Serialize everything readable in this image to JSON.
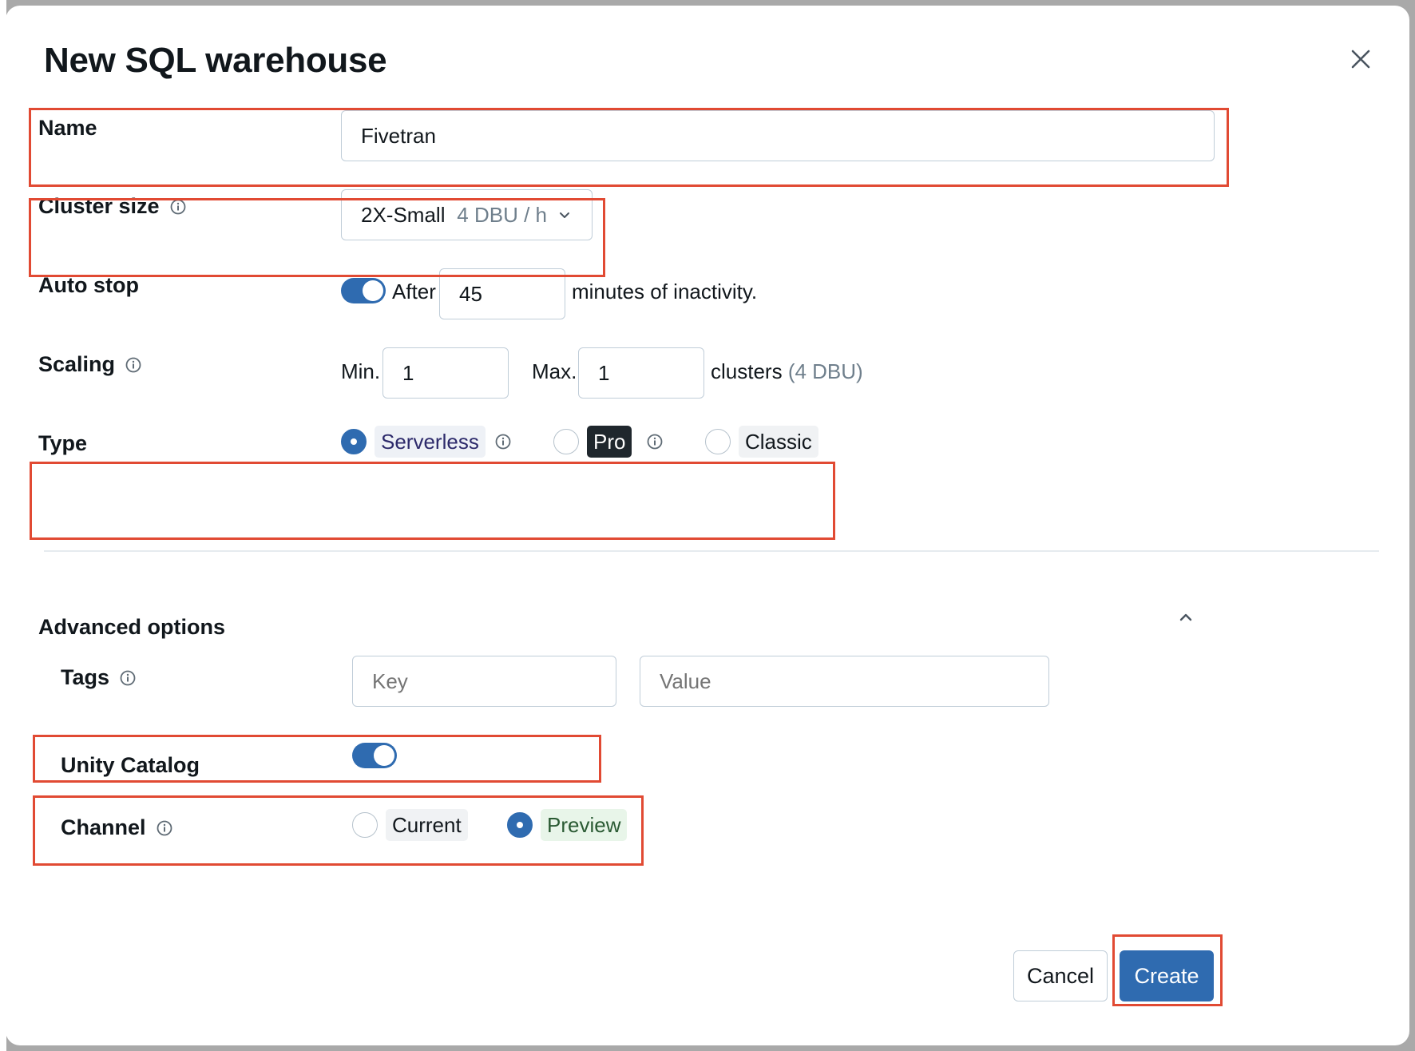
{
  "dialog": {
    "title": "New SQL warehouse",
    "close_icon": "close-icon"
  },
  "name": {
    "label": "Name",
    "value": "Fivetran"
  },
  "cluster_size": {
    "label": "Cluster size",
    "value": "2X-Small",
    "rate": "4 DBU / h"
  },
  "auto_stop": {
    "label": "Auto stop",
    "enabled": true,
    "prefix": "After",
    "value": "45",
    "suffix": "minutes of inactivity."
  },
  "scaling": {
    "label": "Scaling",
    "min_label": "Min.",
    "min_value": "1",
    "max_label": "Max.",
    "max_value": "1",
    "suffix": "clusters",
    "dbu": "(4 DBU)"
  },
  "type": {
    "label": "Type",
    "options": [
      {
        "label": "Serverless",
        "selected": true
      },
      {
        "label": "Pro",
        "selected": false
      },
      {
        "label": "Classic",
        "selected": false
      }
    ]
  },
  "advanced": {
    "label": "Advanced options",
    "tags": {
      "label": "Tags",
      "key_placeholder": "Key",
      "value_placeholder": "Value"
    },
    "unity_catalog": {
      "label": "Unity Catalog",
      "enabled": true
    },
    "channel": {
      "label": "Channel",
      "options": [
        {
          "label": "Current",
          "selected": false
        },
        {
          "label": "Preview",
          "selected": true
        }
      ]
    }
  },
  "footer": {
    "cancel_label": "Cancel",
    "create_label": "Create"
  },
  "colors": {
    "accent": "#2f6bb0",
    "highlight": "#e14a33"
  }
}
